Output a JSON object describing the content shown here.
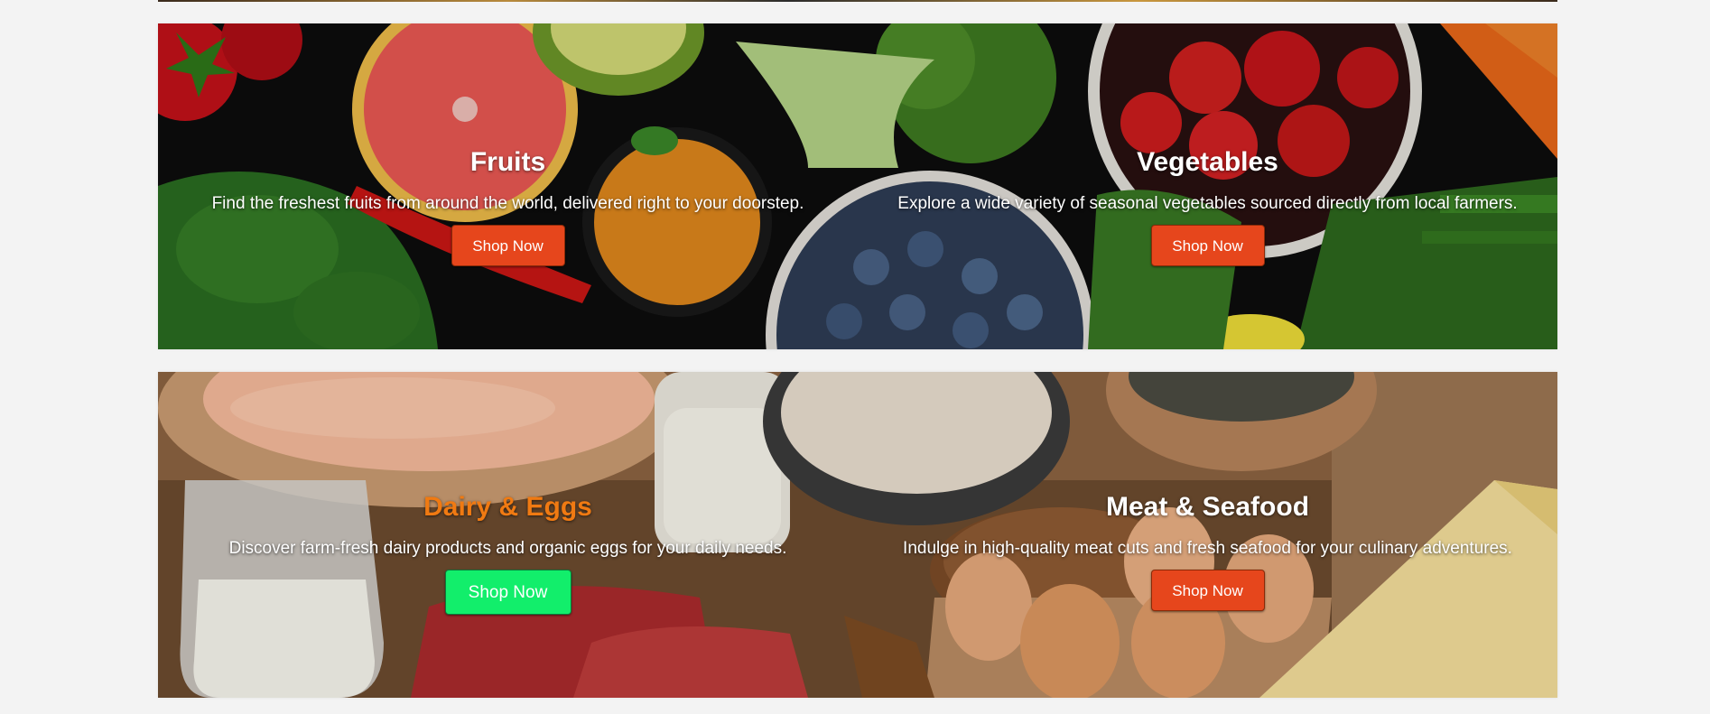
{
  "colors": {
    "page_background": "#f3f3f3",
    "button_primary": "#e6461c",
    "button_hover_green": "#12ee6b",
    "title_highlight": "#f07a12",
    "text": "#ffffff"
  },
  "banners": [
    {
      "image": "fresh-produce-photo",
      "cards": [
        {
          "title": "Fruits",
          "description": "Find the freshest fruits from around the world, delivered right to your doorstep.",
          "button_label": "Shop Now"
        },
        {
          "title": "Vegetables",
          "description": "Explore a wide variety of seasonal vegetables sourced directly from local farmers.",
          "button_label": "Shop Now"
        }
      ]
    },
    {
      "image": "dairy-meat-eggs-photo",
      "cards": [
        {
          "title": "Dairy & Eggs",
          "description": "Discover farm-fresh dairy products and organic eggs for your daily needs.",
          "button_label": "Shop Now",
          "state": "hovered"
        },
        {
          "title": "Meat & Seafood",
          "description": "Indulge in high-quality meat cuts and fresh seafood for your culinary adventures.",
          "button_label": "Shop Now"
        }
      ]
    }
  ]
}
